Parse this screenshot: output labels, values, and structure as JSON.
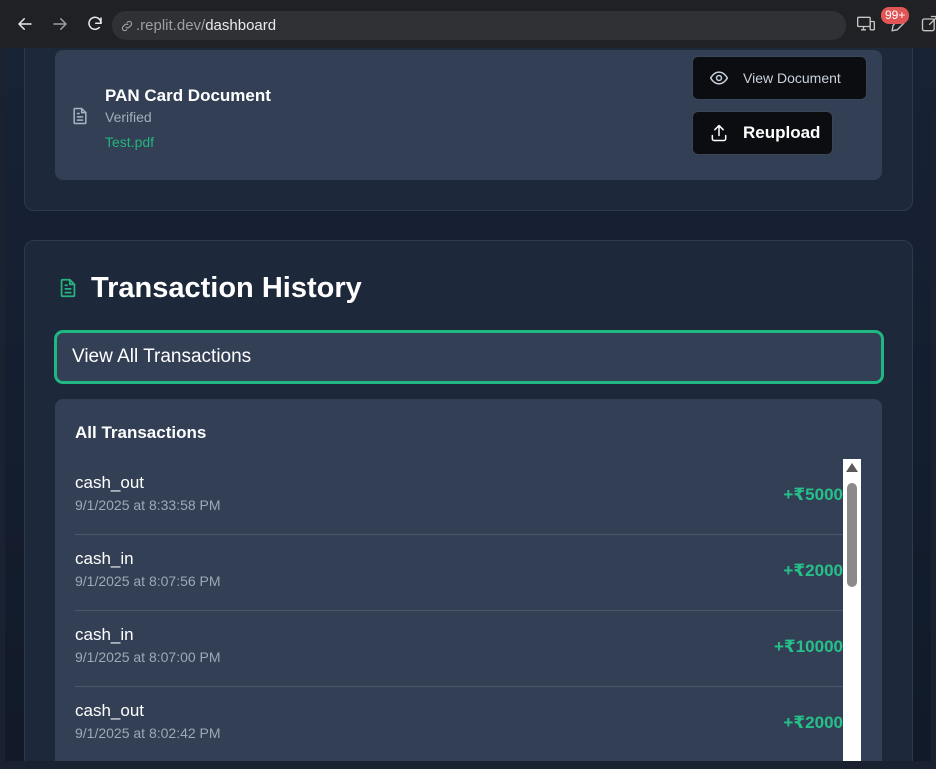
{
  "browser": {
    "url_host": ".replit.dev/",
    "url_path": "dashboard",
    "badge": "99+"
  },
  "document": {
    "title": "PAN Card Document",
    "status": "Verified",
    "file": "Test.pdf",
    "view_label": "View Document",
    "reupload_label": "Reupload"
  },
  "transactions": {
    "title": "Transaction History",
    "view_all_label": "View All Transactions",
    "list_heading": "All Transactions",
    "items": [
      {
        "type": "cash_out",
        "time": "9/1/2025 at 8:33:58 PM",
        "amount": "+₹5000"
      },
      {
        "type": "cash_in",
        "time": "9/1/2025 at 8:07:56 PM",
        "amount": "+₹2000"
      },
      {
        "type": "cash_in",
        "time": "9/1/2025 at 8:07:00 PM",
        "amount": "+₹10000"
      },
      {
        "type": "cash_out",
        "time": "9/1/2025 at 8:02:42 PM",
        "amount": "+₹2000"
      }
    ]
  },
  "colors": {
    "accent": "#25b37e",
    "page_bg": "#172235",
    "panel_bg": "#323f54"
  }
}
